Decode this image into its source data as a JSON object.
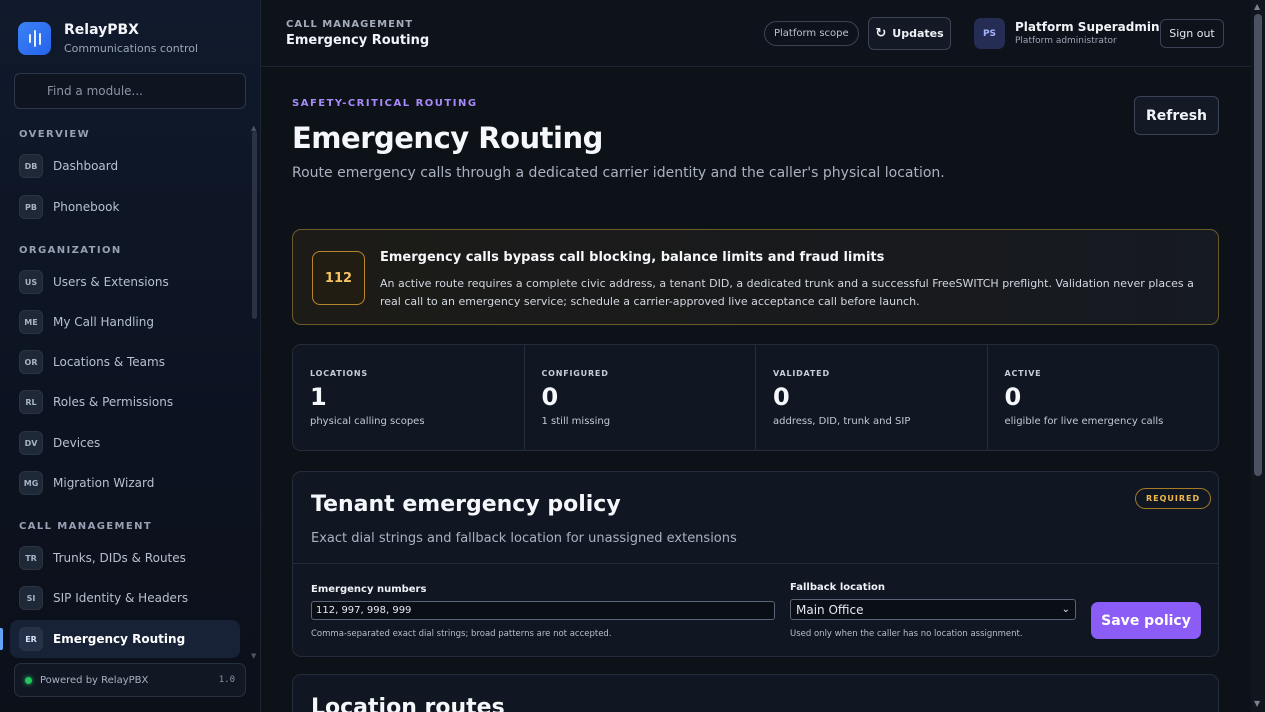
{
  "brand": {
    "name": "RelayPBX",
    "subtitle": "Communications control"
  },
  "search": {
    "placeholder": "Find a module..."
  },
  "sidebar": {
    "sections": [
      {
        "label": "OVERVIEW"
      },
      {
        "label": "ORGANIZATION"
      },
      {
        "label": "CALL MANAGEMENT"
      }
    ],
    "items": [
      {
        "badge": "DB",
        "label": "Dashboard"
      },
      {
        "badge": "PB",
        "label": "Phonebook"
      },
      {
        "badge": "US",
        "label": "Users & Extensions"
      },
      {
        "badge": "ME",
        "label": "My Call Handling"
      },
      {
        "badge": "OR",
        "label": "Locations & Teams"
      },
      {
        "badge": "RL",
        "label": "Roles & Permissions"
      },
      {
        "badge": "DV",
        "label": "Devices"
      },
      {
        "badge": "MG",
        "label": "Migration Wizard"
      },
      {
        "badge": "TR",
        "label": "Trunks, DIDs & Routes"
      },
      {
        "badge": "SI",
        "label": "SIP Identity & Headers"
      },
      {
        "badge": "ER",
        "label": "Emergency Routing"
      }
    ],
    "footer": {
      "text": "Powered by RelayPBX",
      "version": "1.0"
    }
  },
  "topbar": {
    "crumb": "CALL MANAGEMENT",
    "title": "Emergency Routing",
    "scope": "Platform scope",
    "updates": "Updates",
    "user_initials": "PS",
    "user_name": "Platform Superadmin",
    "user_role": "Platform administrator",
    "sign_out": "Sign out"
  },
  "page": {
    "eyebrow": "SAFETY-CRITICAL ROUTING",
    "title": "Emergency Routing",
    "subtitle": "Route emergency calls through a dedicated carrier identity and the caller's physical location.",
    "refresh": "Refresh"
  },
  "alert": {
    "badge": "112",
    "title": "Emergency calls bypass call blocking, balance limits and fraud limits",
    "body": "An active route requires a complete civic address, a tenant DID, a dedicated trunk and a successful FreeSWITCH preflight. Validation never places a real call to an emergency service; schedule a carrier-approved live acceptance call before launch."
  },
  "stats": [
    {
      "label": "LOCATIONS",
      "value": "1",
      "note": "physical calling scopes"
    },
    {
      "label": "CONFIGURED",
      "value": "0",
      "note": "1 still missing"
    },
    {
      "label": "VALIDATED",
      "value": "0",
      "note": "address, DID, trunk and SIP"
    },
    {
      "label": "ACTIVE",
      "value": "0",
      "note": "eligible for live emergency calls"
    }
  ],
  "policy": {
    "title": "Tenant emergency policy",
    "subtitle": "Exact dial strings and fallback location for unassigned extensions",
    "required": "REQUIRED",
    "numbers_label": "Emergency numbers",
    "numbers_value": "112, 997, 998, 999",
    "numbers_help": "Comma-separated exact dial strings; broad patterns are not accepted.",
    "fallback_label": "Fallback location",
    "fallback_value": "Main Office",
    "fallback_help": "Used only when the caller has no location assignment.",
    "save": "Save policy"
  },
  "routes": {
    "title": "Location routes"
  },
  "colors": {
    "accent": "#8b5cf6",
    "eyebrow": "#a78bfa",
    "warning": "#f5c361",
    "status_ok": "#22c55e"
  }
}
